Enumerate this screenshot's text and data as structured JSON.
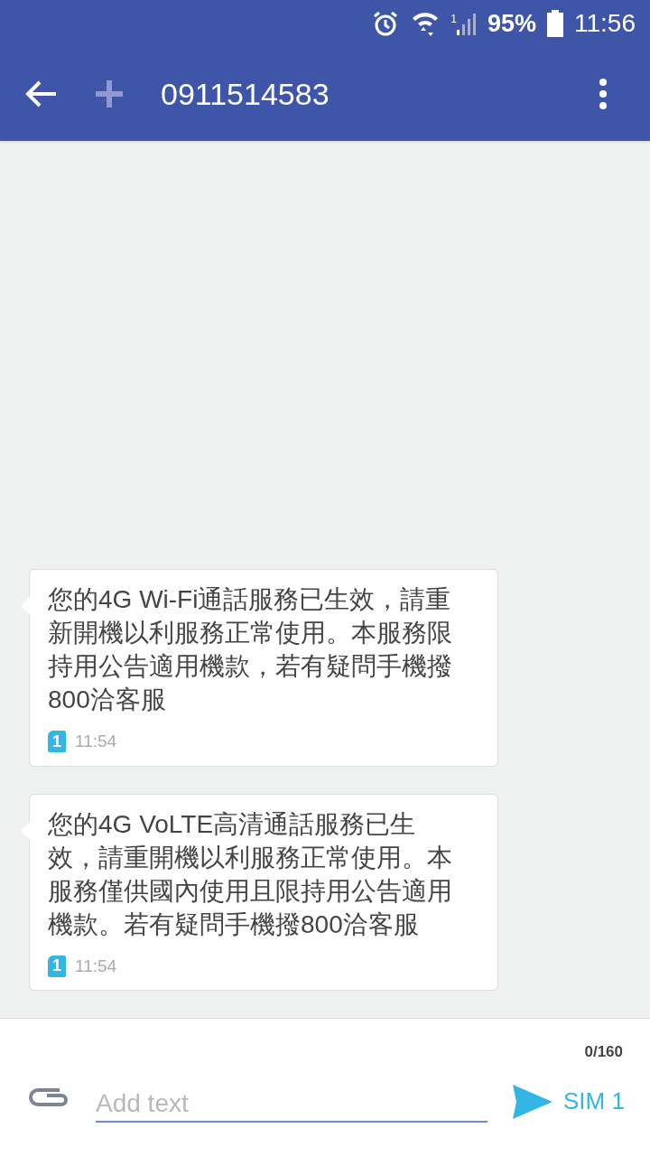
{
  "status_bar": {
    "signal_sim": "1",
    "battery": "95%",
    "time": "11:56"
  },
  "app_bar": {
    "title": "0911514583"
  },
  "messages": [
    {
      "text": "您的4G Wi-Fi通話服務已生效，請重新開機以利服務正常使用。本服務限持用公告適用機款，若有疑問手機撥800洽客服",
      "sim": "1",
      "time": "11:54"
    },
    {
      "text": "您的4G VoLTE高清通話服務已生效，請重開機以利服務正常使用。本服務僅供國內使用且限持用公告適用機款。若有疑問手機撥800洽客服",
      "sim": "1",
      "time": "11:54"
    }
  ],
  "composer": {
    "counter": "0/160",
    "placeholder": "Add text",
    "send_label": "SIM 1"
  }
}
